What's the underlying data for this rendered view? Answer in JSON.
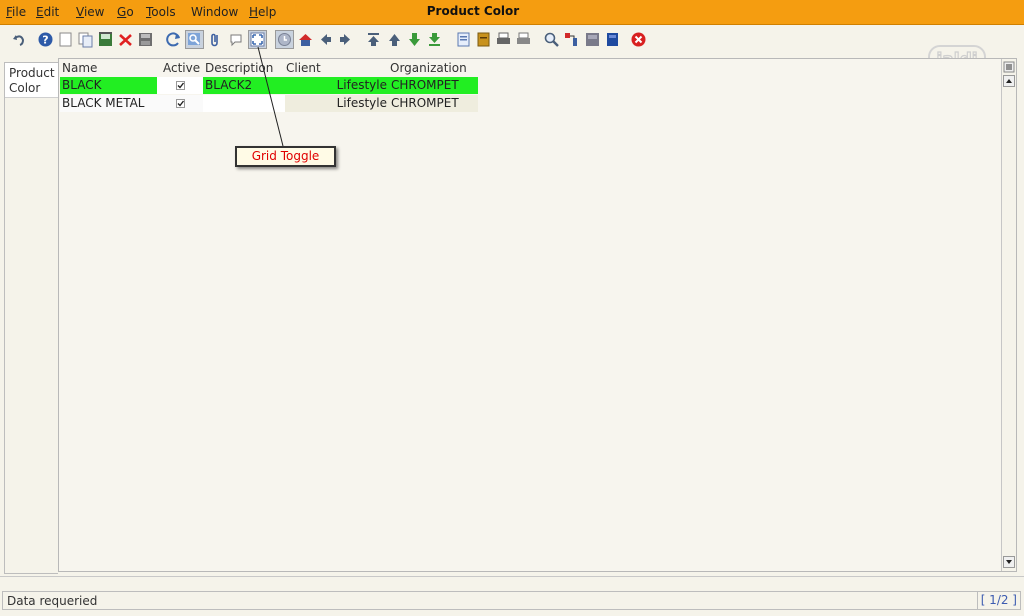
{
  "window": {
    "title": "Product Color"
  },
  "menu": [
    {
      "pre": "",
      "key": "F",
      "post": "ile"
    },
    {
      "pre": "",
      "key": "E",
      "post": "dit"
    },
    {
      "pre": "",
      "key": "V",
      "post": "iew"
    },
    {
      "pre": "",
      "key": "G",
      "post": "o"
    },
    {
      "pre": "",
      "key": "T",
      "post": "ools"
    },
    {
      "pre": "Window",
      "key": "",
      "post": ""
    },
    {
      "pre": "",
      "key": "H",
      "post": "elp"
    }
  ],
  "toolbar": {
    "icons": [
      "undo",
      "help",
      "new",
      "copy",
      "save-new",
      "delete",
      "save",
      "refresh",
      "find",
      "attachment",
      "chat",
      "grid-toggle",
      "history",
      "home",
      "previous",
      "next",
      "first",
      "up",
      "down",
      "last",
      "report",
      "archive",
      "print",
      "print-preview",
      "zoom",
      "request",
      "product-info",
      "workflow",
      "exit"
    ]
  },
  "logo": {
    "text": "jaldi"
  },
  "side_tab": {
    "label": "Product Color"
  },
  "grid": {
    "columns": [
      "Name",
      "Active",
      "Description",
      "Client",
      "Organization"
    ],
    "rows": [
      {
        "name": "BLACK",
        "active": true,
        "description": "BLACK2",
        "client": "Lifestyle",
        "organization": "CHROMPET"
      },
      {
        "name": "BLACK METAL",
        "active": true,
        "description": "",
        "client": "Lifestyle",
        "organization": "CHROMPET"
      }
    ]
  },
  "annotation": {
    "label": "Grid Toggle"
  },
  "status": {
    "message": "Data requeried",
    "record_count": "[ 1/2 ]"
  },
  "colors": {
    "menubar": "#f59d10",
    "selected_row": "#22ee22",
    "annotation_text": "#e00000"
  }
}
